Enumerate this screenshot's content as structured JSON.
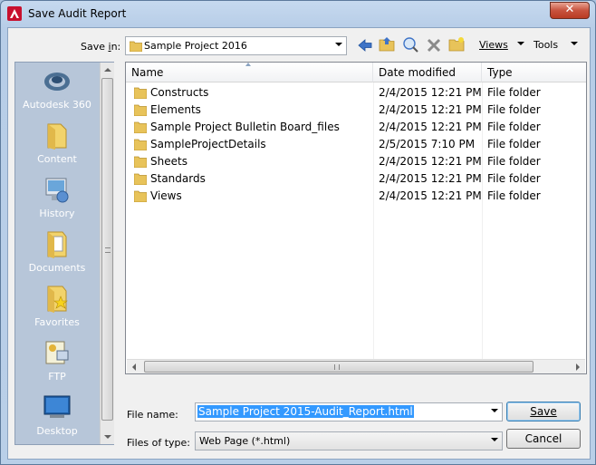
{
  "window": {
    "title": "Save Audit Report",
    "close_glyph": "✕"
  },
  "save_in": {
    "label": "Save in:",
    "label_hotkey_index": 5,
    "value": "Sample Project 2016"
  },
  "toolbar": {
    "views_label": "Views",
    "tools_label": "Tools"
  },
  "places": [
    {
      "label": "Autodesk 360",
      "icon": "autodesk-360-icon"
    },
    {
      "label": "Content",
      "icon": "folder-icon"
    },
    {
      "label": "History",
      "icon": "history-icon"
    },
    {
      "label": "Documents",
      "icon": "documents-icon"
    },
    {
      "label": "Favorites",
      "icon": "favorites-icon"
    },
    {
      "label": "FTP",
      "icon": "ftp-icon"
    },
    {
      "label": "Desktop",
      "icon": "desktop-icon"
    }
  ],
  "file_list": {
    "columns": [
      "Name",
      "Date modified",
      "Type"
    ],
    "rows": [
      {
        "name": "Constructs",
        "date": "2/4/2015 12:21 PM",
        "type": "File folder"
      },
      {
        "name": "Elements",
        "date": "2/4/2015 12:21 PM",
        "type": "File folder"
      },
      {
        "name": "Sample Project Bulletin Board_files",
        "date": "2/4/2015 12:21 PM",
        "type": "File folder"
      },
      {
        "name": "SampleProjectDetails",
        "date": "2/5/2015 7:10 PM",
        "type": "File folder"
      },
      {
        "name": "Sheets",
        "date": "2/4/2015 12:21 PM",
        "type": "File folder"
      },
      {
        "name": "Standards",
        "date": "2/4/2015 12:21 PM",
        "type": "File folder"
      },
      {
        "name": "Views",
        "date": "2/4/2015 12:21 PM",
        "type": "File folder"
      }
    ]
  },
  "file_name": {
    "label": "File name:",
    "value": "Sample Project 2015-Audit_Report.html"
  },
  "file_type": {
    "label": "Files of type:",
    "value": "Web Page (*.html)"
  },
  "buttons": {
    "save": "Save",
    "cancel": "Cancel"
  },
  "colors": {
    "accent": "#3399ff",
    "places_bg": "#b7c6d9",
    "folder": "#e8c35a"
  }
}
